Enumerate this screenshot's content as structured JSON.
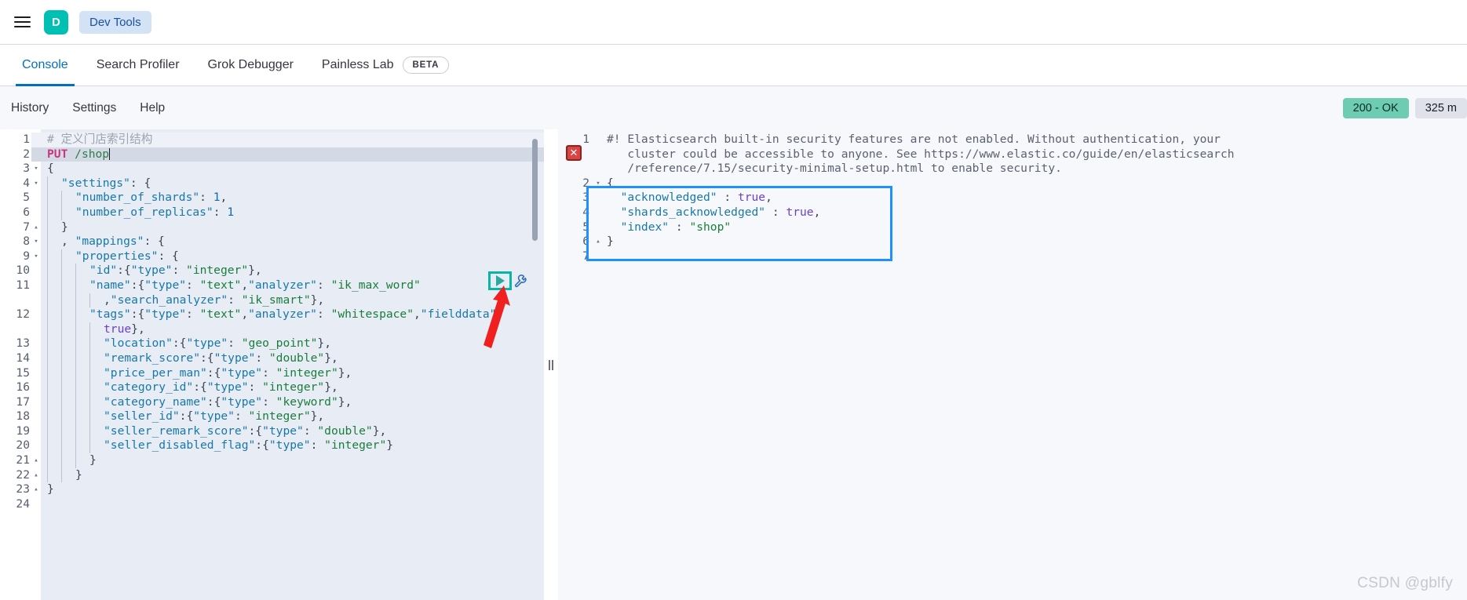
{
  "chrome": {
    "menu_icon": "hamburger-menu-icon",
    "space_initial": "D",
    "breadcrumb": "Dev Tools"
  },
  "tabs": [
    {
      "label": "Console",
      "active": true
    },
    {
      "label": "Search Profiler",
      "active": false
    },
    {
      "label": "Grok Debugger",
      "active": false
    },
    {
      "label": "Painless Lab",
      "active": false,
      "badge": "BETA"
    }
  ],
  "sub_nav": {
    "items": [
      "History",
      "Settings",
      "Help"
    ],
    "status_code": "200 - OK",
    "response_time": "325 m"
  },
  "editor": {
    "play_icon": "play-triangle-icon",
    "wrench_icon": "wrench-icon",
    "lines": [
      {
        "n": "1",
        "fold": "",
        "hl": "soft",
        "indent": 0,
        "tokens": [
          {
            "c": "comment",
            "t": "# 定义门店索引结构"
          }
        ]
      },
      {
        "n": "2",
        "fold": "",
        "hl": "full",
        "indent": 0,
        "tokens": [
          {
            "c": "method",
            "t": "PUT"
          },
          {
            "c": "plain",
            "t": " "
          },
          {
            "c": "url",
            "t": "/shop"
          },
          {
            "c": "caret",
            "t": ""
          }
        ]
      },
      {
        "n": "3",
        "fold": "▾",
        "hl": "",
        "indent": 0,
        "tokens": [
          {
            "c": "punct",
            "t": "{"
          }
        ]
      },
      {
        "n": "4",
        "fold": "▾",
        "hl": "",
        "indent": 1,
        "tokens": [
          {
            "c": "key",
            "t": "\"settings\""
          },
          {
            "c": "punct",
            "t": ": {"
          }
        ]
      },
      {
        "n": "5",
        "fold": "",
        "hl": "",
        "indent": 2,
        "tokens": [
          {
            "c": "key",
            "t": "\"number_of_shards\""
          },
          {
            "c": "punct",
            "t": ": "
          },
          {
            "c": "num",
            "t": "1"
          },
          {
            "c": "punct",
            "t": ","
          }
        ]
      },
      {
        "n": "6",
        "fold": "",
        "hl": "",
        "indent": 2,
        "tokens": [
          {
            "c": "key",
            "t": "\"number_of_replicas\""
          },
          {
            "c": "punct",
            "t": ": "
          },
          {
            "c": "num",
            "t": "1"
          }
        ]
      },
      {
        "n": "7",
        "fold": "▴",
        "hl": "",
        "indent": 1,
        "tokens": [
          {
            "c": "punct",
            "t": "}"
          }
        ]
      },
      {
        "n": "8",
        "fold": "▾",
        "hl": "",
        "indent": 1,
        "tokens": [
          {
            "c": "punct",
            "t": ", "
          },
          {
            "c": "key",
            "t": "\"mappings\""
          },
          {
            "c": "punct",
            "t": ": {"
          }
        ]
      },
      {
        "n": "9",
        "fold": "▾",
        "hl": "",
        "indent": 2,
        "tokens": [
          {
            "c": "key",
            "t": "\"properties\""
          },
          {
            "c": "punct",
            "t": ": {"
          }
        ]
      },
      {
        "n": "10",
        "fold": "",
        "hl": "",
        "indent": 3,
        "tokens": [
          {
            "c": "key",
            "t": "\"id\""
          },
          {
            "c": "punct",
            "t": ":{"
          },
          {
            "c": "key",
            "t": "\"type\""
          },
          {
            "c": "punct",
            "t": ": "
          },
          {
            "c": "str",
            "t": "\"integer\""
          },
          {
            "c": "punct",
            "t": "},"
          }
        ]
      },
      {
        "n": "11",
        "fold": "",
        "hl": "",
        "indent": 3,
        "tokens": [
          {
            "c": "key",
            "t": "\"name\""
          },
          {
            "c": "punct",
            "t": ":{"
          },
          {
            "c": "key",
            "t": "\"type\""
          },
          {
            "c": "punct",
            "t": ": "
          },
          {
            "c": "str",
            "t": "\"text\""
          },
          {
            "c": "punct",
            "t": ","
          },
          {
            "c": "key",
            "t": "\"analyzer\""
          },
          {
            "c": "punct",
            "t": ": "
          },
          {
            "c": "str",
            "t": "\"ik_max_word\""
          }
        ]
      },
      {
        "n": "",
        "fold": "",
        "hl": "",
        "indent": 4,
        "tokens": [
          {
            "c": "punct",
            "t": ","
          },
          {
            "c": "key",
            "t": "\"search_analyzer\""
          },
          {
            "c": "punct",
            "t": ": "
          },
          {
            "c": "str",
            "t": "\"ik_smart\""
          },
          {
            "c": "punct",
            "t": "},"
          }
        ]
      },
      {
        "n": "12",
        "fold": "",
        "hl": "",
        "indent": 3,
        "tokens": [
          {
            "c": "key",
            "t": "\"tags\""
          },
          {
            "c": "punct",
            "t": ":{"
          },
          {
            "c": "key",
            "t": "\"type\""
          },
          {
            "c": "punct",
            "t": ": "
          },
          {
            "c": "str",
            "t": "\"text\""
          },
          {
            "c": "punct",
            "t": ","
          },
          {
            "c": "key",
            "t": "\"analyzer\""
          },
          {
            "c": "punct",
            "t": ": "
          },
          {
            "c": "str",
            "t": "\"whitespace\""
          },
          {
            "c": "punct",
            "t": ","
          },
          {
            "c": "key",
            "t": "\"fielddata\""
          },
          {
            "c": "punct",
            "t": ":"
          }
        ]
      },
      {
        "n": "",
        "fold": "",
        "hl": "",
        "indent": 4,
        "tokens": [
          {
            "c": "bool",
            "t": "true"
          },
          {
            "c": "punct",
            "t": "},"
          }
        ]
      },
      {
        "n": "13",
        "fold": "",
        "hl": "",
        "indent": 4,
        "tokens": [
          {
            "c": "key",
            "t": "\"location\""
          },
          {
            "c": "punct",
            "t": ":{"
          },
          {
            "c": "key",
            "t": "\"type\""
          },
          {
            "c": "punct",
            "t": ": "
          },
          {
            "c": "str",
            "t": "\"geo_point\""
          },
          {
            "c": "punct",
            "t": "},"
          }
        ]
      },
      {
        "n": "14",
        "fold": "",
        "hl": "",
        "indent": 4,
        "tokens": [
          {
            "c": "key",
            "t": "\"remark_score\""
          },
          {
            "c": "punct",
            "t": ":{"
          },
          {
            "c": "key",
            "t": "\"type\""
          },
          {
            "c": "punct",
            "t": ": "
          },
          {
            "c": "str",
            "t": "\"double\""
          },
          {
            "c": "punct",
            "t": "},"
          }
        ]
      },
      {
        "n": "15",
        "fold": "",
        "hl": "",
        "indent": 4,
        "tokens": [
          {
            "c": "key",
            "t": "\"price_per_man\""
          },
          {
            "c": "punct",
            "t": ":{"
          },
          {
            "c": "key",
            "t": "\"type\""
          },
          {
            "c": "punct",
            "t": ": "
          },
          {
            "c": "str",
            "t": "\"integer\""
          },
          {
            "c": "punct",
            "t": "},"
          }
        ]
      },
      {
        "n": "16",
        "fold": "",
        "hl": "",
        "indent": 4,
        "tokens": [
          {
            "c": "key",
            "t": "\"category_id\""
          },
          {
            "c": "punct",
            "t": ":{"
          },
          {
            "c": "key",
            "t": "\"type\""
          },
          {
            "c": "punct",
            "t": ": "
          },
          {
            "c": "str",
            "t": "\"integer\""
          },
          {
            "c": "punct",
            "t": "},"
          }
        ]
      },
      {
        "n": "17",
        "fold": "",
        "hl": "",
        "indent": 4,
        "tokens": [
          {
            "c": "key",
            "t": "\"category_name\""
          },
          {
            "c": "punct",
            "t": ":{"
          },
          {
            "c": "key",
            "t": "\"type\""
          },
          {
            "c": "punct",
            "t": ": "
          },
          {
            "c": "str",
            "t": "\"keyword\""
          },
          {
            "c": "punct",
            "t": "},"
          }
        ]
      },
      {
        "n": "18",
        "fold": "",
        "hl": "",
        "indent": 4,
        "tokens": [
          {
            "c": "key",
            "t": "\"seller_id\""
          },
          {
            "c": "punct",
            "t": ":{"
          },
          {
            "c": "key",
            "t": "\"type\""
          },
          {
            "c": "punct",
            "t": ": "
          },
          {
            "c": "str",
            "t": "\"integer\""
          },
          {
            "c": "punct",
            "t": "},"
          }
        ]
      },
      {
        "n": "19",
        "fold": "",
        "hl": "",
        "indent": 4,
        "tokens": [
          {
            "c": "key",
            "t": "\"seller_remark_score\""
          },
          {
            "c": "punct",
            "t": ":{"
          },
          {
            "c": "key",
            "t": "\"type\""
          },
          {
            "c": "punct",
            "t": ": "
          },
          {
            "c": "str",
            "t": "\"double\""
          },
          {
            "c": "punct",
            "t": "},"
          }
        ]
      },
      {
        "n": "20",
        "fold": "",
        "hl": "",
        "indent": 4,
        "tokens": [
          {
            "c": "key",
            "t": "\"seller_disabled_flag\""
          },
          {
            "c": "punct",
            "t": ":{"
          },
          {
            "c": "key",
            "t": "\"type\""
          },
          {
            "c": "punct",
            "t": ": "
          },
          {
            "c": "str",
            "t": "\"integer\""
          },
          {
            "c": "punct",
            "t": "}"
          }
        ]
      },
      {
        "n": "21",
        "fold": "▴",
        "hl": "",
        "indent": 3,
        "tokens": [
          {
            "c": "punct",
            "t": "}"
          }
        ]
      },
      {
        "n": "22",
        "fold": "▴",
        "hl": "",
        "indent": 2,
        "tokens": [
          {
            "c": "punct",
            "t": "}"
          }
        ]
      },
      {
        "n": "23",
        "fold": "▴",
        "hl": "",
        "indent": 0,
        "tokens": [
          {
            "c": "punct",
            "t": "}"
          }
        ]
      },
      {
        "n": "24",
        "fold": "",
        "hl": "",
        "indent": 0,
        "tokens": []
      }
    ]
  },
  "response": {
    "error_marker": "error-x-icon",
    "lines": [
      {
        "n": "1",
        "fold": "",
        "cls": "warn",
        "tokens": [
          {
            "c": "warn",
            "t": "#! Elasticsearch built-in security features are not enabled. Without authentication, your"
          }
        ]
      },
      {
        "n": "",
        "fold": "",
        "cls": "warn",
        "tokens": [
          {
            "c": "warn",
            "t": "   cluster could be accessible to anyone. See https://www.elastic.co/guide/en/elasticsearch"
          }
        ]
      },
      {
        "n": "",
        "fold": "",
        "cls": "warn",
        "tokens": [
          {
            "c": "warn",
            "t": "   /reference/7.15/security-minimal-setup.html to enable security."
          }
        ]
      },
      {
        "n": "2",
        "fold": "▾",
        "cls": "",
        "tokens": [
          {
            "c": "punct",
            "t": "{"
          }
        ]
      },
      {
        "n": "3",
        "fold": "",
        "cls": "",
        "tokens": [
          {
            "c": "punct",
            "t": "  "
          },
          {
            "c": "key",
            "t": "\"acknowledged\""
          },
          {
            "c": "punct",
            "t": " : "
          },
          {
            "c": "bool",
            "t": "true"
          },
          {
            "c": "punct",
            "t": ","
          }
        ]
      },
      {
        "n": "4",
        "fold": "",
        "cls": "",
        "tokens": [
          {
            "c": "punct",
            "t": "  "
          },
          {
            "c": "key",
            "t": "\"shards_acknowledged\""
          },
          {
            "c": "punct",
            "t": " : "
          },
          {
            "c": "bool",
            "t": "true"
          },
          {
            "c": "punct",
            "t": ","
          }
        ]
      },
      {
        "n": "5",
        "fold": "",
        "cls": "",
        "tokens": [
          {
            "c": "punct",
            "t": "  "
          },
          {
            "c": "key",
            "t": "\"index\""
          },
          {
            "c": "punct",
            "t": " : "
          },
          {
            "c": "str",
            "t": "\"shop\""
          }
        ]
      },
      {
        "n": "6",
        "fold": "▴",
        "cls": "",
        "tokens": [
          {
            "c": "punct",
            "t": "}"
          }
        ]
      },
      {
        "n": "7",
        "fold": "",
        "cls": "",
        "tokens": []
      }
    ]
  },
  "watermark": "CSDN @gblfy",
  "colors": {
    "accent": "#0071c2",
    "brand_teal": "#00bfb3",
    "status_ok": "#6dccb1",
    "highlight_blue": "#1e90ff",
    "highlight_teal": "#0ab5a8",
    "arrow_red": "#f02020"
  }
}
